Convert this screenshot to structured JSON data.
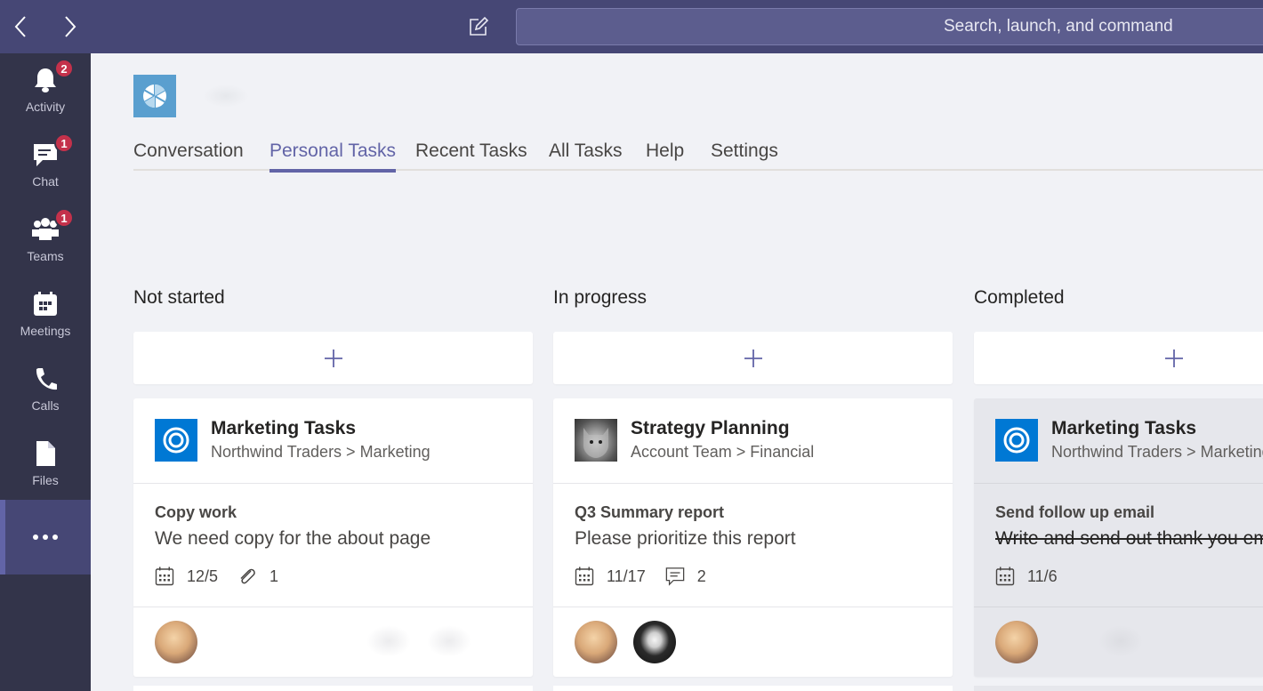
{
  "topbar": {
    "search_placeholder": "Search, launch, and command",
    "back_icon": "chevron-left-icon",
    "forward_icon": "chevron-right-icon",
    "compose_icon": "compose-icon"
  },
  "rail": {
    "items": [
      {
        "label": "Activity",
        "icon": "bell-icon",
        "badge": "2"
      },
      {
        "label": "Chat",
        "icon": "chat-icon",
        "badge": "1"
      },
      {
        "label": "Teams",
        "icon": "teams-icon",
        "badge": "1"
      },
      {
        "label": "Meetings",
        "icon": "calendar-icon",
        "badge": ""
      },
      {
        "label": "Calls",
        "icon": "phone-icon",
        "badge": ""
      },
      {
        "label": "Files",
        "icon": "file-icon",
        "badge": ""
      }
    ],
    "more_icon": "more-icon"
  },
  "tabs": [
    {
      "label": "Conversation"
    },
    {
      "label": "Personal Tasks",
      "active": true
    },
    {
      "label": "Recent Tasks"
    },
    {
      "label": "All Tasks"
    },
    {
      "label": "Help"
    },
    {
      "label": "Settings"
    }
  ],
  "columns": [
    {
      "title": "Not started",
      "card": {
        "plan_title": "Marketing Tasks",
        "plan_path": "Northwind Traders > Marketing",
        "task_title": "Copy work",
        "task_desc": "We need copy for the about page",
        "due": "12/5",
        "second_meta_icon": "paperclip-icon",
        "second_meta_value": "1"
      }
    },
    {
      "title": "In progress",
      "card": {
        "plan_title": "Strategy Planning",
        "plan_path": "Account Team > Financial",
        "task_title": "Q3 Summary report",
        "task_desc": "Please prioritize this report",
        "due": "11/17",
        "second_meta_icon": "comment-icon",
        "second_meta_value": "2"
      }
    },
    {
      "title": "Completed",
      "card": {
        "plan_title": "Marketing Tasks",
        "plan_path": "Northwind Traders > Marketing",
        "task_title": "Send follow up email",
        "task_desc": "Write and send out thank you emails",
        "due": "11/6"
      }
    }
  ],
  "colors": {
    "accent": "#6264a7",
    "topbar": "#464775",
    "rail": "#33344a",
    "badge": "#c4314b",
    "planner_blue": "#0078d4"
  }
}
